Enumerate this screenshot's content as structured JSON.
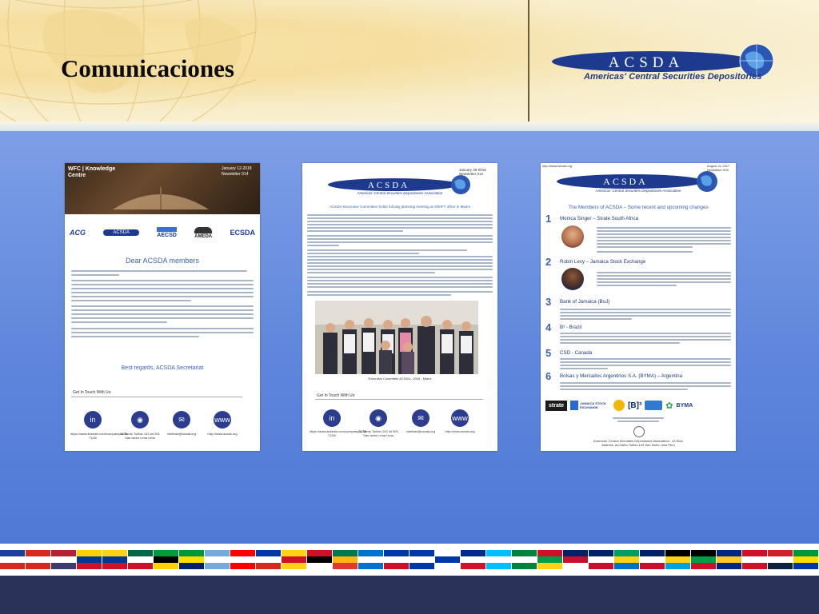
{
  "header": {
    "title": "Comunicaciones",
    "logo_text": "ACSDA",
    "logo_subtitle": "Americas' Central Securities Depositories"
  },
  "newsletters": [
    {
      "header_title": "WFC | Knowledge Centre",
      "date": "January 12-2018",
      "issue": "Newsletter 014",
      "partner_logos": [
        "ACG",
        "ACSDA",
        "AECSD",
        "AMEDA",
        "ECSDA"
      ],
      "greeting": "Dear ACSDA members",
      "signoff": "Best regards, ACSDA Secretariat",
      "get_in_touch": "Get In Touch With Us:",
      "contacts": [
        {
          "icon": "in",
          "text": "https://www.linkedin.com/company/1135 7126/"
        },
        {
          "icon": "pin",
          "text": "Av.Santo Toribio 143 Int 501 San Isidro Lima Lima"
        },
        {
          "icon": "mail",
          "text": "vbeltran@acsda.org"
        },
        {
          "icon": "www",
          "text": "http://www.acsda.org"
        }
      ]
    },
    {
      "date": "January 29-2018",
      "issue": "Newsletter 013",
      "logo_text": "ACSDA",
      "logo_subtitle": "Americas' Central Securities Depositories Association",
      "headline": "ACSDA Executive Committee holds full day planning meeting at SWIFT office in Miami",
      "photo_caption": "Executive Committee ACSDA - 2018 - Miami",
      "get_in_touch": "Get In Touch With Us:",
      "contacts": [
        {
          "icon": "in",
          "text": "https://www.linkedin.com/company/1135 7126/"
        },
        {
          "icon": "pin",
          "text": "Av.Santo Toribio 143 Int 501 San Isidro Lima Lima"
        },
        {
          "icon": "mail",
          "text": "vbeltran@acsda.org"
        },
        {
          "icon": "www",
          "text": "http://www.acsda.org"
        }
      ]
    },
    {
      "url_top": "http://www.acsda.org",
      "date": "August 21-2017",
      "issue": "Newsletter 005",
      "logo_text": "ACSDA",
      "logo_subtitle": "Americas' Central Securities Depositories Association",
      "headline": "The Members of ACSDA – Some recent and upcoming changes",
      "items": [
        {
          "num": "1",
          "title": "Monica Singer – Strate South Africa"
        },
        {
          "num": "2",
          "title": "Robin Levy – Jamaica Stock Exchange"
        },
        {
          "num": "3",
          "title": "Bank of Jamaica (BoJ)"
        },
        {
          "num": "4",
          "title": "B³ - Brazil"
        },
        {
          "num": "5",
          "title": "CSD - Canada"
        },
        {
          "num": "6",
          "title": "Bolsas y Mercados Argentinos S.A. (BYMA) – Argentina"
        }
      ],
      "member_logos": [
        "strate",
        "JAMAICA STOCK EXCHANGE",
        "[B]³",
        "BYMA"
      ],
      "footer_lines": [
        "Americas' Central Securities Depositories Association - ACSDA",
        "Address: Av.Santo Toribio 143 San Isidro Lima Peru"
      ]
    }
  ],
  "flag_colors": [
    [
      "#1d3f9e",
      "#ffffff",
      "#d52b1e"
    ],
    [
      "#d52b1e",
      "#ffffff",
      "#d52b1e"
    ],
    [
      "#b22234",
      "#ffffff",
      "#3c3b6e"
    ],
    [
      "#ffd100",
      "#003893",
      "#ce1126"
    ],
    [
      "#fcd116",
      "#003893",
      "#ce1126"
    ],
    [
      "#006847",
      "#ffffff",
      "#ce1126"
    ],
    [
      "#009b3a",
      "#000000",
      "#fed100"
    ],
    [
      "#009739",
      "#fedd00",
      "#012169"
    ],
    [
      "#75aadb",
      "#ffffff",
      "#75aadb"
    ],
    [
      "#ff0000",
      "#ffffff",
      "#ff0000"
    ],
    [
      "#0039a6",
      "#ffffff",
      "#d52b1e"
    ],
    [
      "#fcd116",
      "#ce1126",
      "#fcd116"
    ],
    [
      "#ce1126",
      "#000000",
      "#ffffff"
    ],
    [
      "#007a4d",
      "#ffb612",
      "#de3831"
    ],
    [
      "#0073cf",
      "#ffffff",
      "#0073cf"
    ],
    [
      "#0038a8",
      "#ffffff",
      "#ce1126"
    ],
    [
      "#0038a8",
      "#ffffff",
      "#0038a8"
    ],
    [
      "#ffffff",
      "#0038a8",
      "#ffffff"
    ],
    [
      "#002a8f",
      "#ffffff",
      "#cf142b"
    ],
    [
      "#00bfff",
      "#ffffff",
      "#00bfff"
    ],
    [
      "#00843d",
      "#ffffff",
      "#00843d"
    ],
    [
      "#ce1126",
      "#009e49",
      "#fcd116"
    ],
    [
      "#012169",
      "#c8102e",
      "#ffffff"
    ],
    [
      "#012169",
      "#ffffff",
      "#c8102e"
    ],
    [
      "#009e60",
      "#fcd116",
      "#0072c6"
    ],
    [
      "#012169",
      "#ffffff",
      "#c8102e"
    ],
    [
      "#000000",
      "#fcd116",
      "#00a3dd"
    ],
    [
      "#000000",
      "#009e49",
      "#ce1126"
    ],
    [
      "#00267f",
      "#ffc726",
      "#00267f"
    ],
    [
      "#ce1126",
      "#ffffff",
      "#ce1126"
    ],
    [
      "#cf2027",
      "#ffffff",
      "#0c2340"
    ],
    [
      "#009739",
      "#fedd00",
      "#0038a8"
    ]
  ]
}
